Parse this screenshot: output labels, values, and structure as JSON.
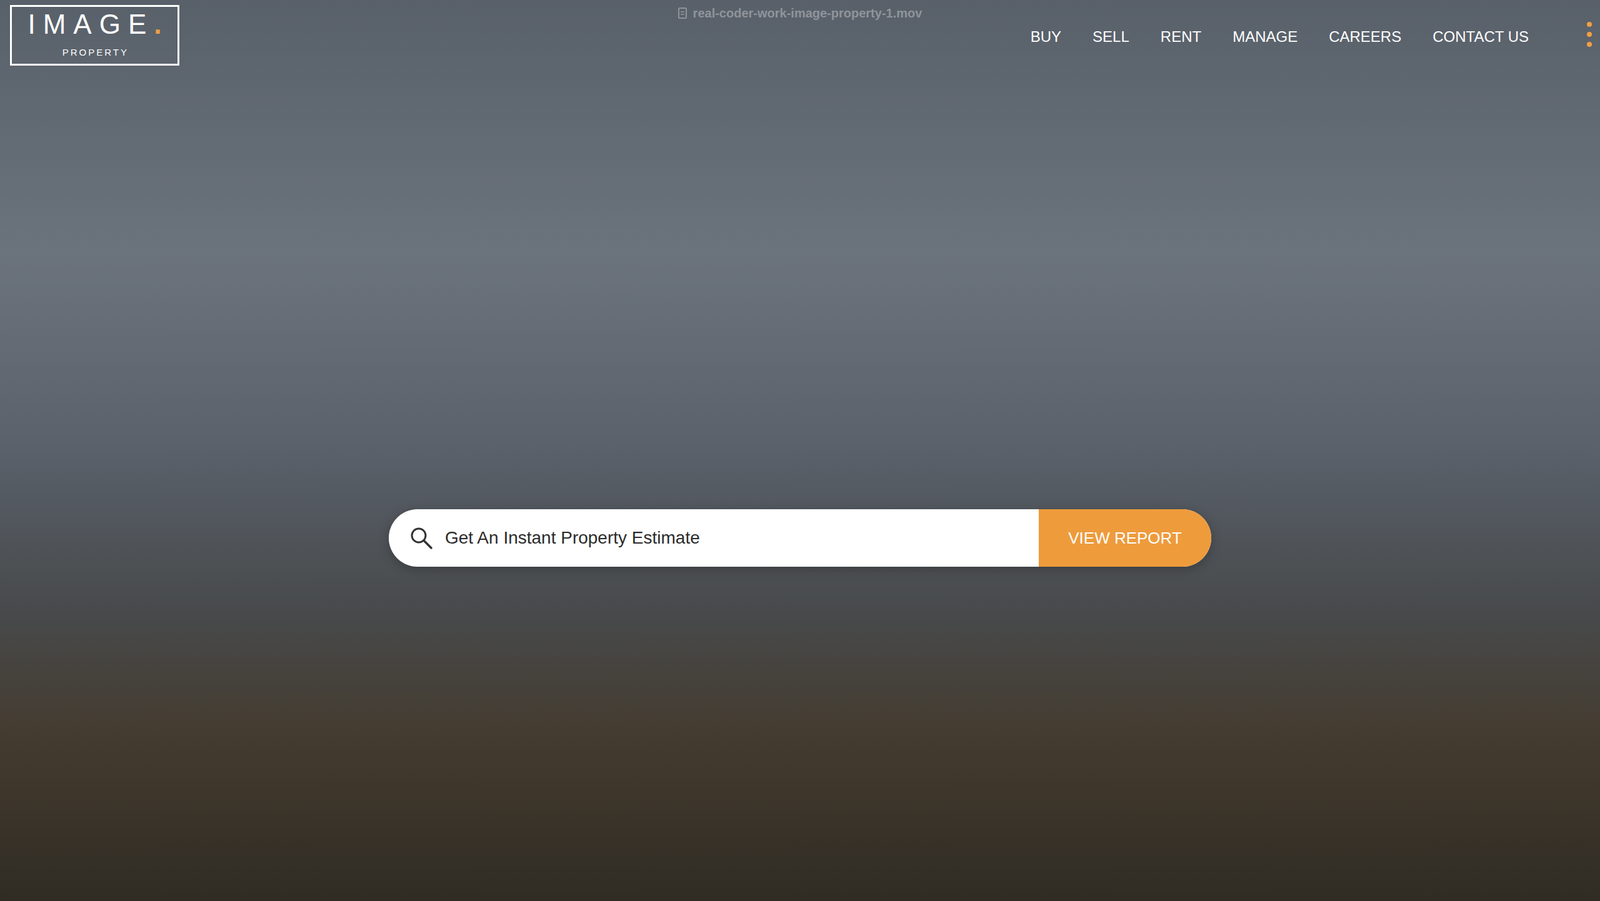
{
  "window": {
    "title": "real-coder-work-image-property-1.mov"
  },
  "logo": {
    "name": "IMAGE",
    "dot": ".",
    "tagline": "PROPERTY"
  },
  "nav": {
    "items": [
      "BUY",
      "SELL",
      "RENT",
      "MANAGE",
      "CAREERS",
      "CONTACT US"
    ]
  },
  "search": {
    "placeholder": "Get An Instant Property Estimate",
    "button": "VIEW REPORT"
  }
}
